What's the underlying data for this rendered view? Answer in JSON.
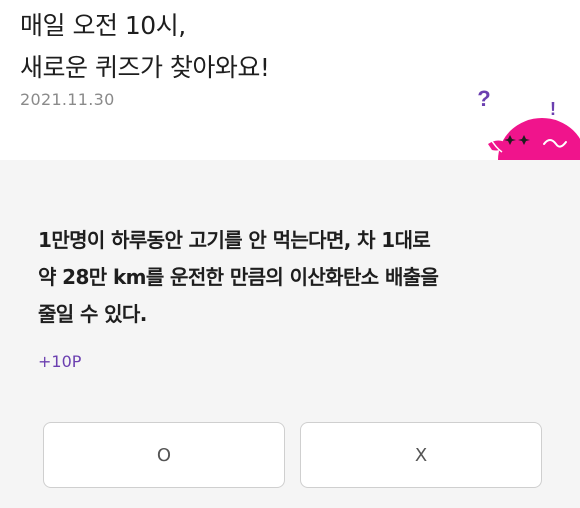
{
  "header": {
    "title_line1": "매일 오전 10시,",
    "title_line2": "새로운 퀴즈가 찾아와요!",
    "date": "2021.11.30"
  },
  "mascot": {
    "question_mark": "?",
    "exclamation_mark": "!",
    "body_color": "#f0148c",
    "mark_color": "#6b3fb0"
  },
  "quiz": {
    "question_line1": "1만명이 하루동안 고기를 안 먹는다면, 차 1대로",
    "question_line2": "약 28만 km를 운전한 만큼의 이산화탄소 배출을",
    "question_line3": "줄일 수 있다.",
    "points": "+10P",
    "answer_o": "O",
    "answer_x": "X"
  }
}
